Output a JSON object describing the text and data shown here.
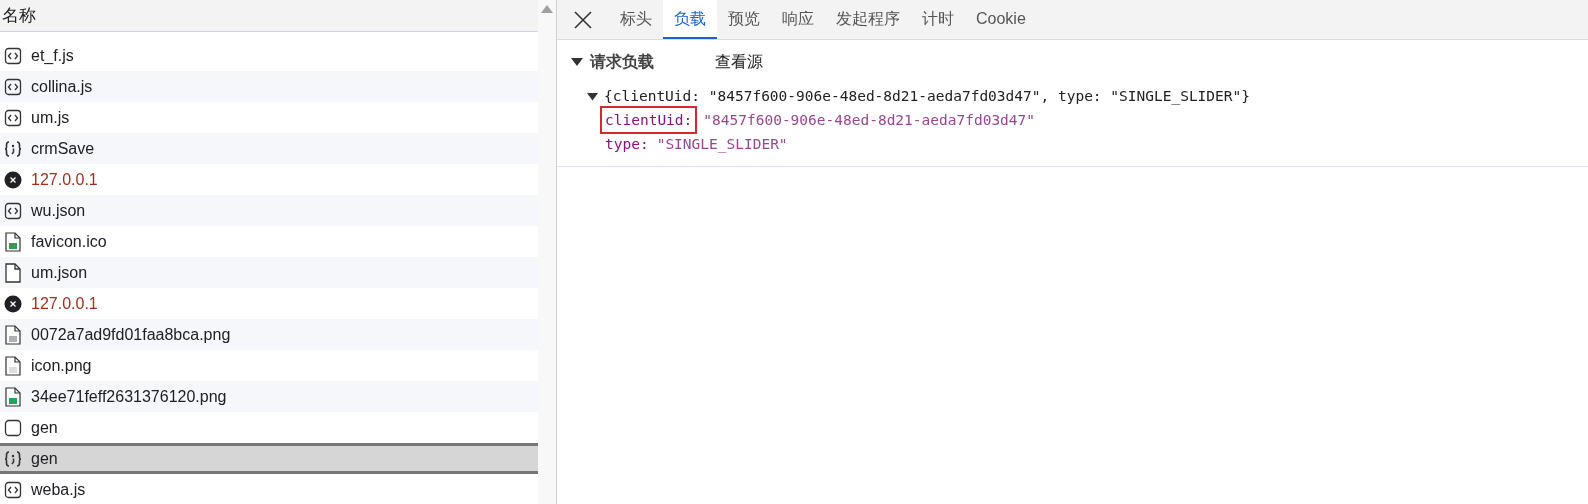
{
  "requests": {
    "column_header": "名称",
    "rows": [
      {
        "name": "et_f.js",
        "kind": "script",
        "selected": false
      },
      {
        "name": "collina.js",
        "kind": "script",
        "selected": false
      },
      {
        "name": "um.js",
        "kind": "script",
        "selected": false
      },
      {
        "name": "crmSave",
        "kind": "fetch",
        "selected": false
      },
      {
        "name": "127.0.0.1",
        "kind": "error",
        "selected": false
      },
      {
        "name": "wu.json",
        "kind": "script",
        "selected": false
      },
      {
        "name": "favicon.ico",
        "kind": "image",
        "color": "#2e9e4f",
        "selected": false
      },
      {
        "name": "um.json",
        "kind": "document",
        "selected": false
      },
      {
        "name": "127.0.0.1",
        "kind": "error",
        "selected": false
      },
      {
        "name": "0072a7ad9fd01faa8bca.png",
        "kind": "image",
        "color": "#b0b0b0",
        "selected": false
      },
      {
        "name": "icon.png",
        "kind": "image",
        "color": "#dddddd",
        "selected": false
      },
      {
        "name": "34ee71feff2631376120.png",
        "kind": "image",
        "color": "#22a55b",
        "selected": false
      },
      {
        "name": "gen",
        "kind": "other",
        "selected": false
      },
      {
        "name": "gen",
        "kind": "fetch",
        "selected": true
      },
      {
        "name": "weba.js",
        "kind": "script",
        "selected": false
      }
    ]
  },
  "tabs": [
    {
      "label": "标头",
      "selected": false
    },
    {
      "label": "负载",
      "selected": true
    },
    {
      "label": "预览",
      "selected": false
    },
    {
      "label": "响应",
      "selected": false
    },
    {
      "label": "发起程序",
      "selected": false
    },
    {
      "label": "计时",
      "selected": false
    },
    {
      "label": "Cookie",
      "selected": false
    }
  ],
  "payload": {
    "section_title": "请求负载",
    "expanded": true,
    "view_source": "查看源",
    "object": {
      "summary": "{clientUid: \"8457f600-906e-48ed-8d21-aeda7fd03d47\", type: \"SINGLE_SLIDER\"}",
      "expanded": true,
      "fields": [
        {
          "key": "clientUid:",
          "value": "\"8457f600-906e-48ed-8d21-aeda7fd03d47\"",
          "highlighted": true
        },
        {
          "key": "type:",
          "value": "\"SINGLE_SLIDER\"",
          "highlighted": false
        }
      ]
    }
  }
}
